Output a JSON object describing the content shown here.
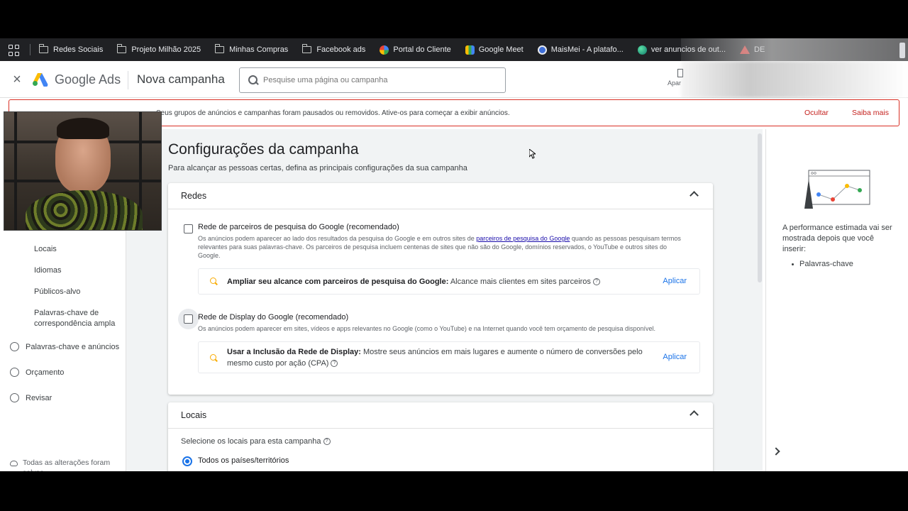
{
  "bookmarks": {
    "items": [
      {
        "label": "Redes Sociais",
        "icon": "folder-icon"
      },
      {
        "label": "Projeto Milhão 2025",
        "icon": "folder-icon"
      },
      {
        "label": "Minhas Compras",
        "icon": "folder-icon"
      },
      {
        "label": "Facebook ads",
        "icon": "folder-icon"
      },
      {
        "label": "Portal do Cliente",
        "icon": "portal-icon"
      },
      {
        "label": "Google Meet",
        "icon": "meet-icon"
      },
      {
        "label": "MaisMei - A platafo...",
        "icon": "maismei-icon"
      },
      {
        "label": "ver anuncios de out...",
        "icon": "globe-icon"
      },
      {
        "label": "DE",
        "icon": "adobe-icon"
      }
    ]
  },
  "header": {
    "brand": "Google Ads",
    "page_name": "Nova campanha",
    "search_placeholder": "Pesquise uma página ou campanha",
    "appearance_label": "Apar"
  },
  "alert": {
    "text": "Seus grupos de anúncios e campanhas foram pausados ou removidos. Ative-os para começar a exibir anúncios.",
    "hide": "Ocultar",
    "more": "Saiba mais"
  },
  "sidebar": {
    "sub_items": [
      "Locais",
      "Idiomas",
      "Públicos-alvo",
      "Palavras-chave de correspondência ampla"
    ],
    "steps": [
      "Palavras-chave e anúncios",
      "Orçamento",
      "Revisar"
    ],
    "saved": "Todas as alterações foram salvas"
  },
  "main": {
    "title": "Configurações da campanha",
    "subtitle": "Para alcançar as pessoas certas, defina as principais configurações da sua campanha",
    "networks": {
      "heading": "Redes",
      "search_partners": {
        "title": "Rede de parceiros de pesquisa do Google (recomendado)",
        "desc_before": "Os anúncios podem aparecer ao lado dos resultados da pesquisa do Google e em outros sites de ",
        "desc_link": "parceiros de pesquisa do Google",
        "desc_after": " quando as pessoas pesquisam termos relevantes para suas palavras-chave. Os parceiros de pesquisa incluem centenas de sites que não são do Google, domínios reservados, o YouTube e outros sites do Google.",
        "suggest_bold": "Ampliar seu alcance com parceiros de pesquisa do Google:",
        "suggest_text": " Alcance mais clientes em sites parceiros",
        "apply": "Aplicar"
      },
      "display": {
        "title": "Rede de Display do Google (recomendado)",
        "desc": "Os anúncios podem aparecer em sites, vídeos e apps relevantes no Google (como o YouTube) e na Internet quando você tem orçamento de pesquisa disponível.",
        "suggest_bold": "Usar a Inclusão da Rede de Display:",
        "suggest_text": " Mostre seus anúncios em mais lugares e aumente o número de conversões pelo mesmo custo por ação (CPA)",
        "apply": "Aplicar"
      }
    },
    "locations": {
      "heading": "Locais",
      "label": "Selecione os locais para esta campanha",
      "option_selected": "Todos os países/territórios"
    }
  },
  "right_panel": {
    "text": "A performance estimada vai ser mostrada depois que você inserir:",
    "list_item": "Palavras-chave"
  },
  "colors": {
    "link_blue": "#1a73e8",
    "alert_red": "#d93025",
    "suggest_yellow": "#f9ab00"
  }
}
